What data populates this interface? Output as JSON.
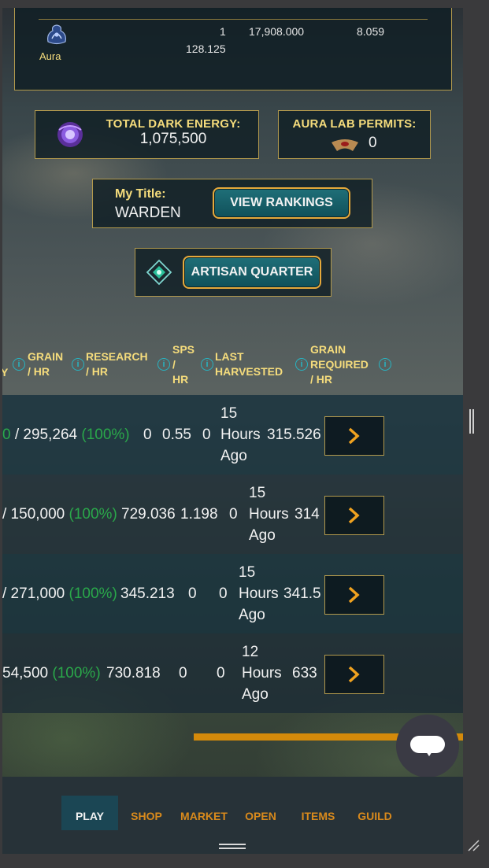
{
  "top_panel": {
    "item_name": "Aura",
    "values": [
      "1",
      "17,908.000",
      "8.059",
      "128.125"
    ]
  },
  "stats": {
    "dark_energy_label": "TOTAL DARK ENERGY:",
    "dark_energy_value": "1,075,500",
    "permits_label": "AURA LAB PERMITS:",
    "permits_value": "0"
  },
  "title_box": {
    "label": "My Title:",
    "value": "WARDEN",
    "rankings_button": "VIEW RANKINGS"
  },
  "artisan_button": "ARTISAN QUARTER",
  "table": {
    "headers": {
      "col0": "Y",
      "grain": [
        "GRAIN",
        "/ HR"
      ],
      "research": [
        "RESEARCH",
        "/ HR"
      ],
      "sps": [
        "SPS",
        "/",
        "HR"
      ],
      "last_harvested": [
        "LAST",
        "HARVESTED"
      ],
      "grain_required": [
        "GRAIN",
        "REQUIRED",
        "/ HR"
      ]
    },
    "info_glyph": "i",
    "rows": [
      {
        "prefix": "0",
        "storage": " / 295,264 ",
        "pct": "(100%)",
        "grain": "0",
        "research": "0.55",
        "sps": "0",
        "harvest": [
          "15",
          "Hours",
          "Ago"
        ],
        "required": "315.526"
      },
      {
        "prefix": "/",
        "storage": " 150,000 ",
        "pct": "(100%)",
        "grain": "729.036",
        "research": "1.198",
        "sps": "0",
        "harvest": [
          "15",
          "Hours",
          "Ago"
        ],
        "required": "314"
      },
      {
        "prefix": "/",
        "storage": " 271,000 ",
        "pct": "(100%)",
        "grain": "345.213",
        "research": "0",
        "sps": "0",
        "harvest": [
          "15",
          "Hours",
          "Ago"
        ],
        "required": "341.5"
      },
      {
        "prefix": "",
        "storage": " 54,500 ",
        "pct": "(100%)",
        "grain": "730.818",
        "research": "0",
        "sps": "0",
        "harvest": [
          "12",
          "Hours",
          "Ago"
        ],
        "required": "633"
      }
    ]
  },
  "nav": {
    "items": [
      {
        "label": "PLAY",
        "active": true
      },
      {
        "label": "SHOP"
      },
      {
        "label": "MARKET"
      },
      {
        "label": "OPEN"
      },
      {
        "label": "ITEMS"
      },
      {
        "label": "GUILD"
      }
    ]
  },
  "colors": {
    "gold": "#f5dc7c",
    "teal": "#1f6f78",
    "orange": "#e6a93b",
    "green": "#2aa84a"
  }
}
